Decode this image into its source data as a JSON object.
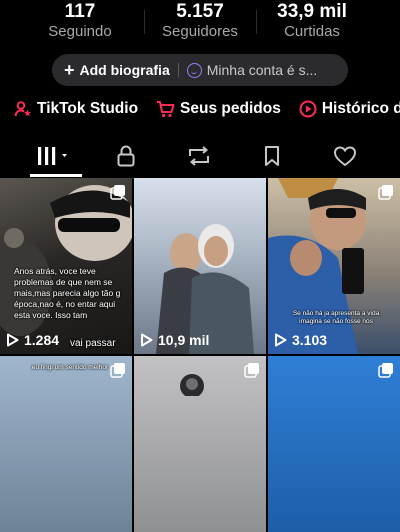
{
  "stats": [
    {
      "value": "117",
      "label": "Seguindo"
    },
    {
      "value": "5.157",
      "label": "Seguidores"
    },
    {
      "value": "33,9 mil",
      "label": "Curtidas"
    }
  ],
  "bio_bar": {
    "add_bio": "Add biografia",
    "account": "Minha conta é s..."
  },
  "quick_links": [
    {
      "label": "TikTok Studio",
      "icon": "person-star-icon",
      "color": "#fe2c55"
    },
    {
      "label": "Seus pedidos",
      "icon": "cart-icon",
      "color": "#fe2c55"
    },
    {
      "label": "Histórico d",
      "icon": "play-circle-icon",
      "color": "#fe2c55"
    }
  ],
  "tabs": [
    "videos-grid-icon",
    "lock-icon",
    "repost-icon",
    "bookmark-icon",
    "heart-icon"
  ],
  "videos": [
    {
      "views": "1.284",
      "caption": "Anos atrás, voce teve problemas de que nem se mais,mas parecia algo tão g época,nao é, no entar aqui esta voce. Isso tam",
      "caption_footer": "vai passar"
    },
    {
      "views": "10,9 mil",
      "caption": ""
    },
    {
      "views": "3.103",
      "caption": "Se não há ja apresenta a vida imagina se não fosse nós"
    },
    {
      "views": "",
      "caption": "eu fingi um sentido melhor"
    },
    {
      "views": "",
      "caption": ""
    },
    {
      "views": "",
      "caption": ""
    }
  ]
}
